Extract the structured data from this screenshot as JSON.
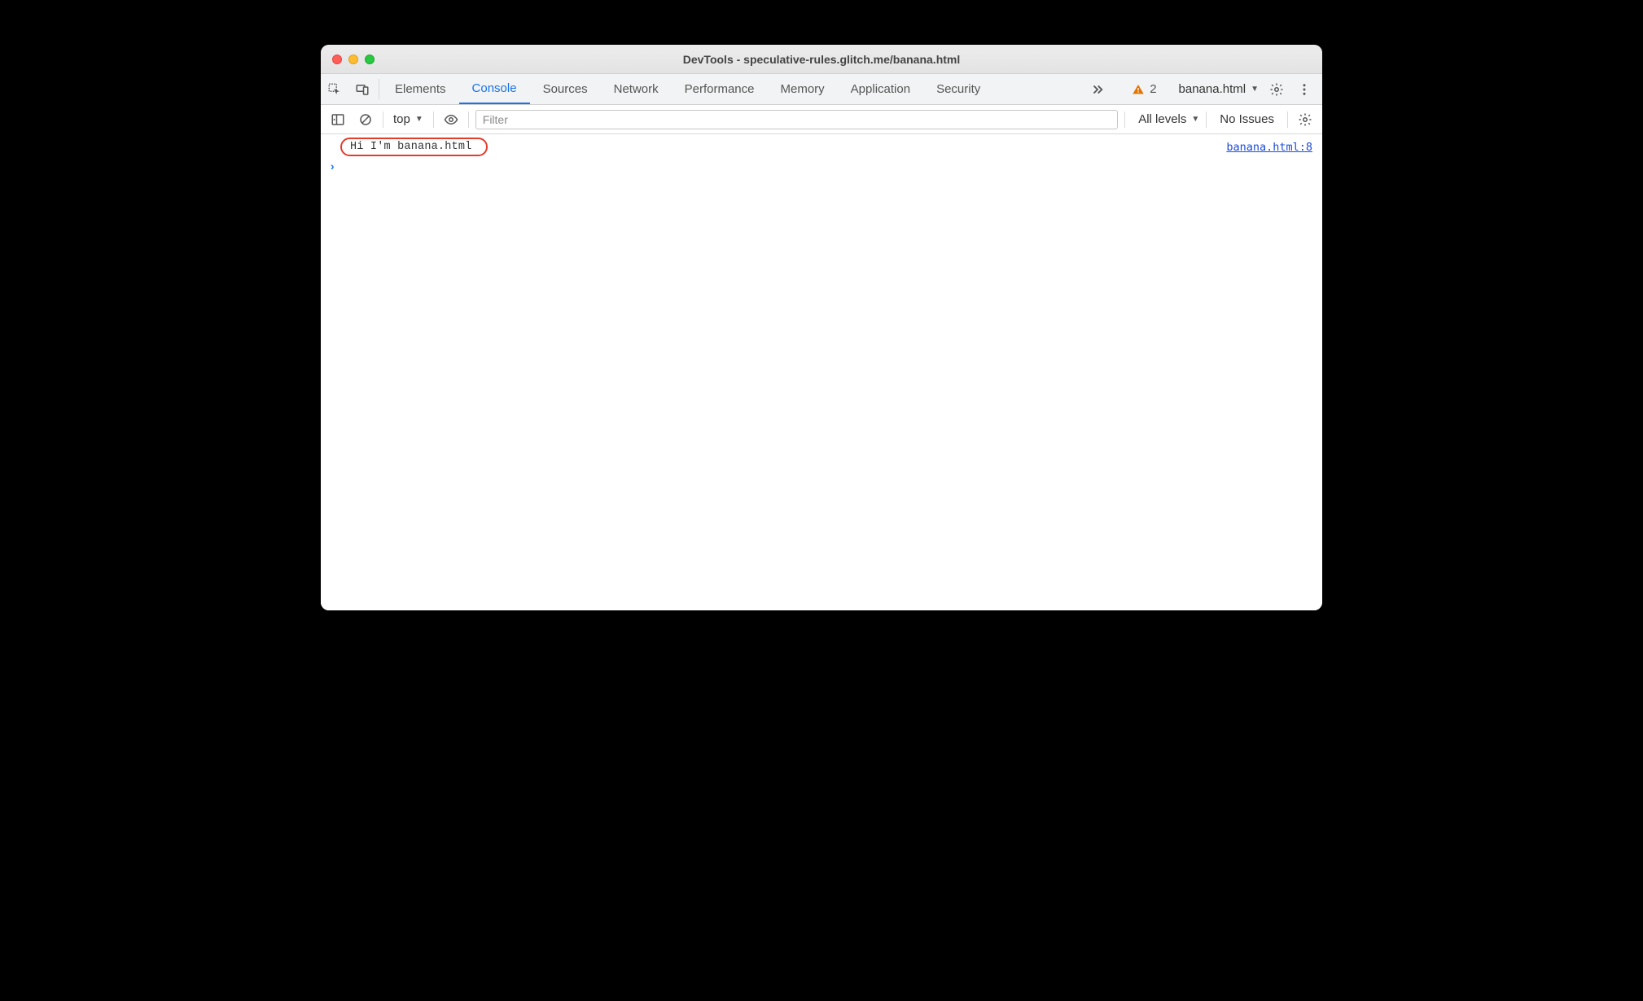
{
  "window": {
    "title": "DevTools - speculative-rules.glitch.me/banana.html"
  },
  "tabs": {
    "items": [
      {
        "label": "Elements"
      },
      {
        "label": "Console"
      },
      {
        "label": "Sources"
      },
      {
        "label": "Network"
      },
      {
        "label": "Performance"
      },
      {
        "label": "Memory"
      },
      {
        "label": "Application"
      },
      {
        "label": "Security"
      }
    ],
    "active_index": 1,
    "warning_count": "2",
    "frame_selector": "banana.html"
  },
  "console_toolbar": {
    "context": "top",
    "filter_placeholder": "Filter",
    "levels_label": "All levels",
    "issues_label": "No Issues"
  },
  "console": {
    "log_message": "Hi I'm banana.html",
    "log_source": "banana.html:8",
    "prompt": "›"
  }
}
